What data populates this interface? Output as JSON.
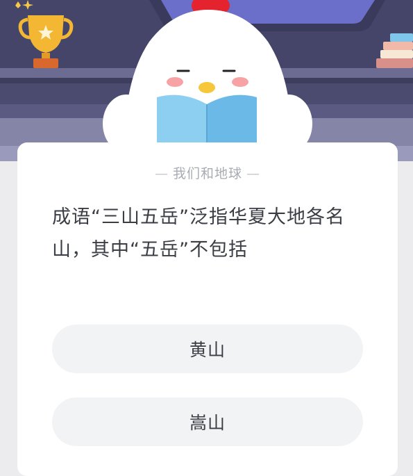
{
  "quiz": {
    "category": "我们和地球",
    "question": "成语“三山五岳”泛指华夏大地各名山，其中“五岳”不包括",
    "options": [
      {
        "label": "黄山"
      },
      {
        "label": "嵩山"
      }
    ]
  },
  "colors": {
    "hero_background": "#4a4a6e",
    "card_background": "#ffffff",
    "option_background": "#f2f3f5",
    "question_text": "#3b3d45",
    "category_text": "#a9acb3"
  },
  "icons": {
    "trophy": "trophy-icon",
    "mascot": "chick-mascot-reading",
    "books": "books-stack-icon"
  }
}
